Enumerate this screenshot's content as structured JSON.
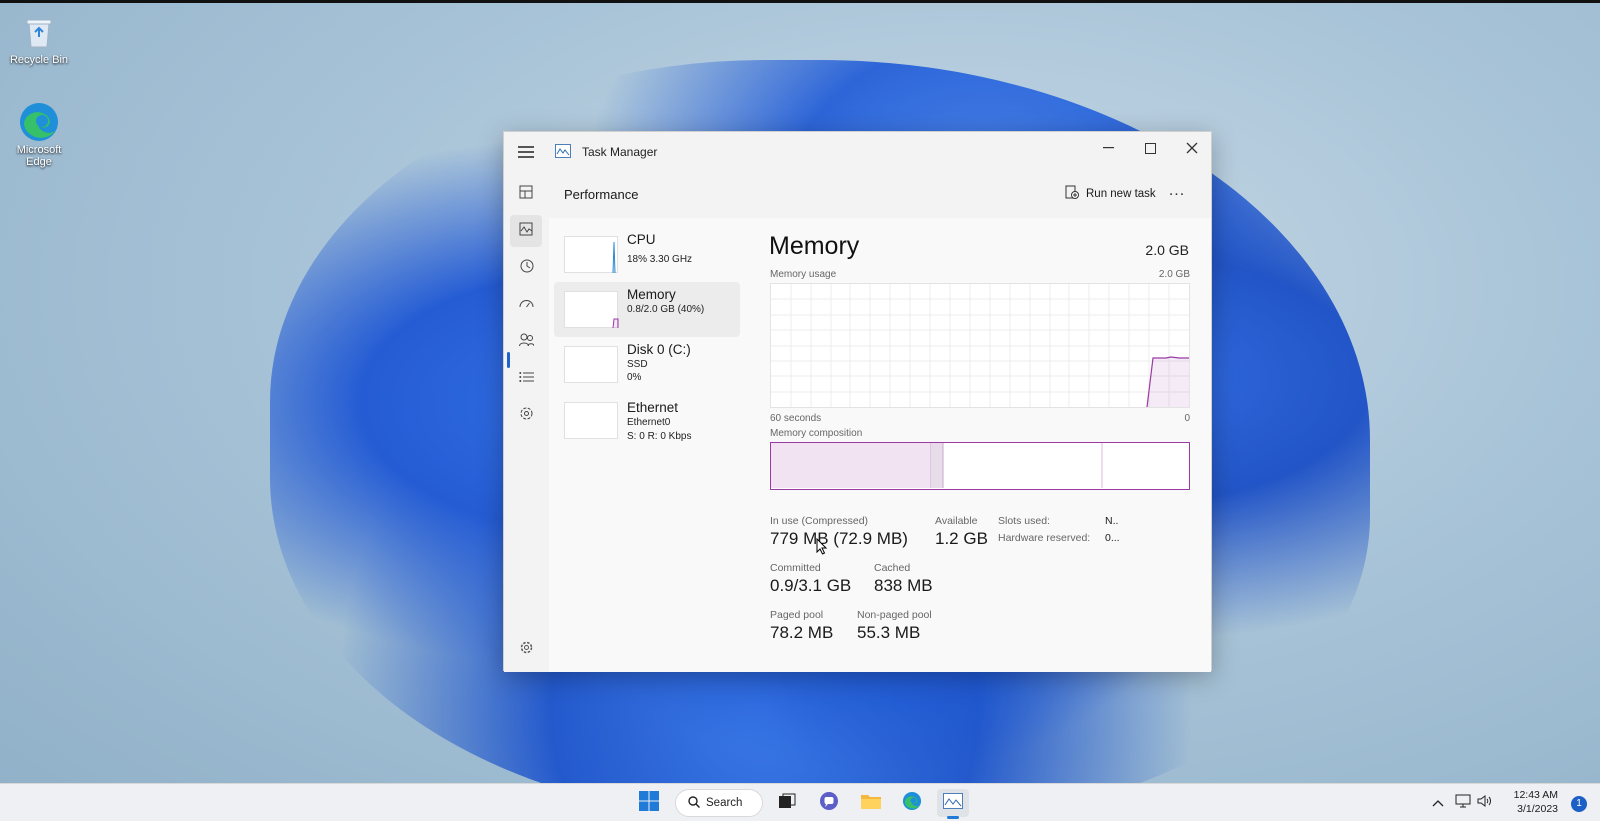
{
  "desktop": {
    "icons": [
      {
        "label": "Recycle Bin",
        "icon": "recycle-bin-icon"
      },
      {
        "label": "Microsoft Edge",
        "icon": "edge-icon"
      }
    ]
  },
  "window": {
    "title": "Task Manager",
    "app_icon": "task-manager-icon",
    "page_title": "Performance",
    "run_new_task": "Run new task",
    "more": "..."
  },
  "devices": [
    {
      "name": "CPU",
      "line1": "18% 3.30 GHz",
      "line2": ""
    },
    {
      "name": "Memory",
      "line1": "0.8/2.0 GB (40%)",
      "line2": ""
    },
    {
      "name": "Disk 0 (C:)",
      "line1": "SSD",
      "line2": "0%"
    },
    {
      "name": "Ethernet",
      "line1": "Ethernet0",
      "line2": "S: 0 R: 0 Kbps"
    }
  ],
  "memory": {
    "title": "Memory",
    "total": "2.0 GB",
    "usage_label": "Memory usage",
    "usage_max": "2.0 GB",
    "time_left": "60 seconds",
    "time_right": "0",
    "composition_label": "Memory composition",
    "composition_fractions": {
      "in_use": 0.38,
      "modified": 0.03,
      "standby": 0.38,
      "free": 0.21
    },
    "stats": {
      "in_use_label": "In use (Compressed)",
      "in_use": "779 MB (72.9 MB)",
      "available_label": "Available",
      "available": "1.2 GB",
      "slots_label": "Slots used:",
      "slots": "N..",
      "hw_reserved_label": "Hardware reserved:",
      "hw_reserved": "0...",
      "committed_label": "Committed",
      "committed": "0.9/3.1 GB",
      "cached_label": "Cached",
      "cached": "838 MB",
      "paged_label": "Paged pool",
      "paged": "78.2 MB",
      "nonpaged_label": "Non-paged pool",
      "nonpaged": "55.3 MB"
    }
  },
  "taskbar": {
    "search": "Search",
    "time": "12:43 AM",
    "date": "3/1/2023",
    "notifications": "1"
  },
  "colors": {
    "memory_accent": "#9a3aa3",
    "cpu_accent": "#2a8bd1",
    "selection_blue": "#2063c8"
  }
}
